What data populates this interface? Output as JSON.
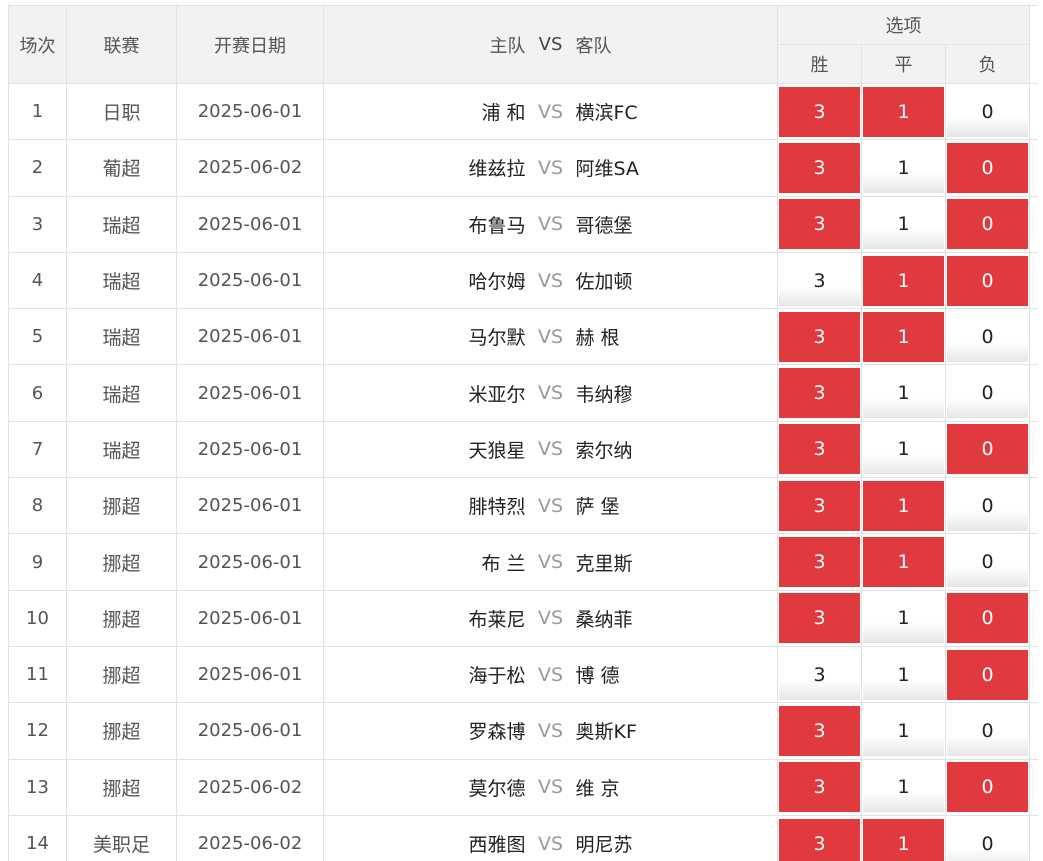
{
  "header": {
    "index": "场次",
    "league": "联赛",
    "date": "开赛日期",
    "home": "主队",
    "vs": "VS",
    "away": "客队",
    "options": "选项",
    "win": "胜",
    "draw": "平",
    "lose": "负"
  },
  "colors": {
    "selected": "#e0393e"
  },
  "rows": [
    {
      "idx": "1",
      "league": "日职",
      "date": "2025-06-01",
      "home": "浦 和",
      "vs": "VS",
      "away": "横滨FC",
      "win": "3",
      "draw": "1",
      "lose": "0",
      "sel": [
        true,
        true,
        false
      ]
    },
    {
      "idx": "2",
      "league": "葡超",
      "date": "2025-06-02",
      "home": "维兹拉",
      "vs": "VS",
      "away": "阿维SA",
      "win": "3",
      "draw": "1",
      "lose": "0",
      "sel": [
        true,
        false,
        true
      ]
    },
    {
      "idx": "3",
      "league": "瑞超",
      "date": "2025-06-01",
      "home": "布鲁马",
      "vs": "VS",
      "away": "哥德堡",
      "win": "3",
      "draw": "1",
      "lose": "0",
      "sel": [
        true,
        false,
        true
      ]
    },
    {
      "idx": "4",
      "league": "瑞超",
      "date": "2025-06-01",
      "home": "哈尔姆",
      "vs": "VS",
      "away": "佐加顿",
      "win": "3",
      "draw": "1",
      "lose": "0",
      "sel": [
        false,
        true,
        true
      ]
    },
    {
      "idx": "5",
      "league": "瑞超",
      "date": "2025-06-01",
      "home": "马尔默",
      "vs": "VS",
      "away": "赫 根",
      "win": "3",
      "draw": "1",
      "lose": "0",
      "sel": [
        true,
        true,
        false
      ]
    },
    {
      "idx": "6",
      "league": "瑞超",
      "date": "2025-06-01",
      "home": "米亚尔",
      "vs": "VS",
      "away": "韦纳穆",
      "win": "3",
      "draw": "1",
      "lose": "0",
      "sel": [
        true,
        false,
        false
      ]
    },
    {
      "idx": "7",
      "league": "瑞超",
      "date": "2025-06-01",
      "home": "天狼星",
      "vs": "VS",
      "away": "索尔纳",
      "win": "3",
      "draw": "1",
      "lose": "0",
      "sel": [
        true,
        false,
        true
      ]
    },
    {
      "idx": "8",
      "league": "挪超",
      "date": "2025-06-01",
      "home": "腓特烈",
      "vs": "VS",
      "away": "萨 堡",
      "win": "3",
      "draw": "1",
      "lose": "0",
      "sel": [
        true,
        true,
        false
      ]
    },
    {
      "idx": "9",
      "league": "挪超",
      "date": "2025-06-01",
      "home": "布 兰",
      "vs": "VS",
      "away": "克里斯",
      "win": "3",
      "draw": "1",
      "lose": "0",
      "sel": [
        true,
        true,
        false
      ]
    },
    {
      "idx": "10",
      "league": "挪超",
      "date": "2025-06-01",
      "home": "布莱尼",
      "vs": "VS",
      "away": "桑纳菲",
      "win": "3",
      "draw": "1",
      "lose": "0",
      "sel": [
        true,
        false,
        true
      ]
    },
    {
      "idx": "11",
      "league": "挪超",
      "date": "2025-06-01",
      "home": "海于松",
      "vs": "VS",
      "away": "博 德",
      "win": "3",
      "draw": "1",
      "lose": "0",
      "sel": [
        false,
        false,
        true
      ]
    },
    {
      "idx": "12",
      "league": "挪超",
      "date": "2025-06-01",
      "home": "罗森博",
      "vs": "VS",
      "away": "奥斯KF",
      "win": "3",
      "draw": "1",
      "lose": "0",
      "sel": [
        true,
        false,
        false
      ]
    },
    {
      "idx": "13",
      "league": "挪超",
      "date": "2025-06-02",
      "home": "莫尔德",
      "vs": "VS",
      "away": "维 京",
      "win": "3",
      "draw": "1",
      "lose": "0",
      "sel": [
        true,
        false,
        true
      ]
    },
    {
      "idx": "14",
      "league": "美职足",
      "date": "2025-06-02",
      "home": "西雅图",
      "vs": "VS",
      "away": "明尼苏",
      "win": "3",
      "draw": "1",
      "lose": "0",
      "sel": [
        true,
        true,
        false
      ]
    }
  ]
}
